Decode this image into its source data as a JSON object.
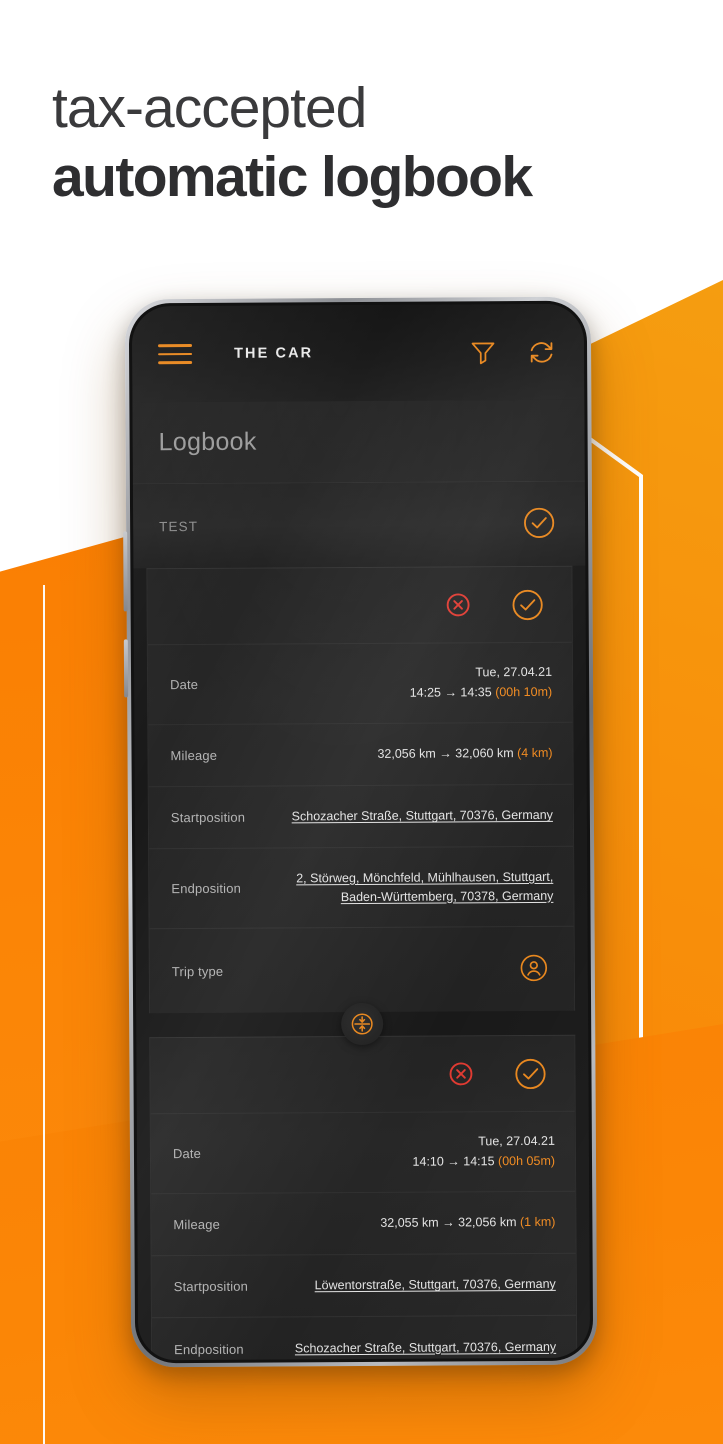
{
  "headline": {
    "line1": "tax-accepted",
    "line2": "automatic logbook"
  },
  "colors": {
    "accent_orange": "#F08A20",
    "bg_orange_left": "#FA7E03",
    "bg_orange_right": "#F59D10",
    "danger_red": "#E03A31",
    "screen_bg": "#1f1f1f"
  },
  "app": {
    "appbar": {
      "menu_icon": "hamburger-menu-icon",
      "title": "THE CAR",
      "filter_icon": "filter-funnel-icon",
      "refresh_icon": "refresh-sync-icon"
    },
    "section": {
      "title": "Logbook"
    },
    "group": {
      "label": "TEST",
      "confirm_icon": "check-circle-icon"
    },
    "labels": {
      "date": "Date",
      "mileage": "Mileage",
      "startposition": "Startposition",
      "endposition": "Endposition",
      "trip_type": "Trip type"
    },
    "icons": {
      "reject": "x-circle-icon",
      "accept": "check-circle-icon",
      "trip_type_private": "person-circle-icon",
      "merge": "merge-trips-icon"
    },
    "trips": [
      {
        "date": "Tue, 27.04.21",
        "time_range": "14:25 → 14:35",
        "duration": "(00h 10m)",
        "mileage_range": "32,056 km → 32,060 km",
        "mileage_delta": "(4 km)",
        "startposition": "Schozacher Straße, Stuttgart, 70376, Germany",
        "endposition_line1": "2, Störweg, Mönchfeld, Mühlhausen, Stuttgart,",
        "endposition_line2": "Baden-Württemberg, 70378, Germany",
        "trip_type_label": "Trip type"
      },
      {
        "date": "Tue, 27.04.21",
        "time_range": "14:10 → 14:15",
        "duration": "(00h 05m)",
        "mileage_range": "32,055 km → 32,056 km",
        "mileage_delta": "(1 km)",
        "startposition": "Löwentorstraße, Stuttgart, 70376, Germany",
        "endposition_line1": "Schozacher Straße, Stuttgart, 70376, Germany"
      }
    ]
  }
}
